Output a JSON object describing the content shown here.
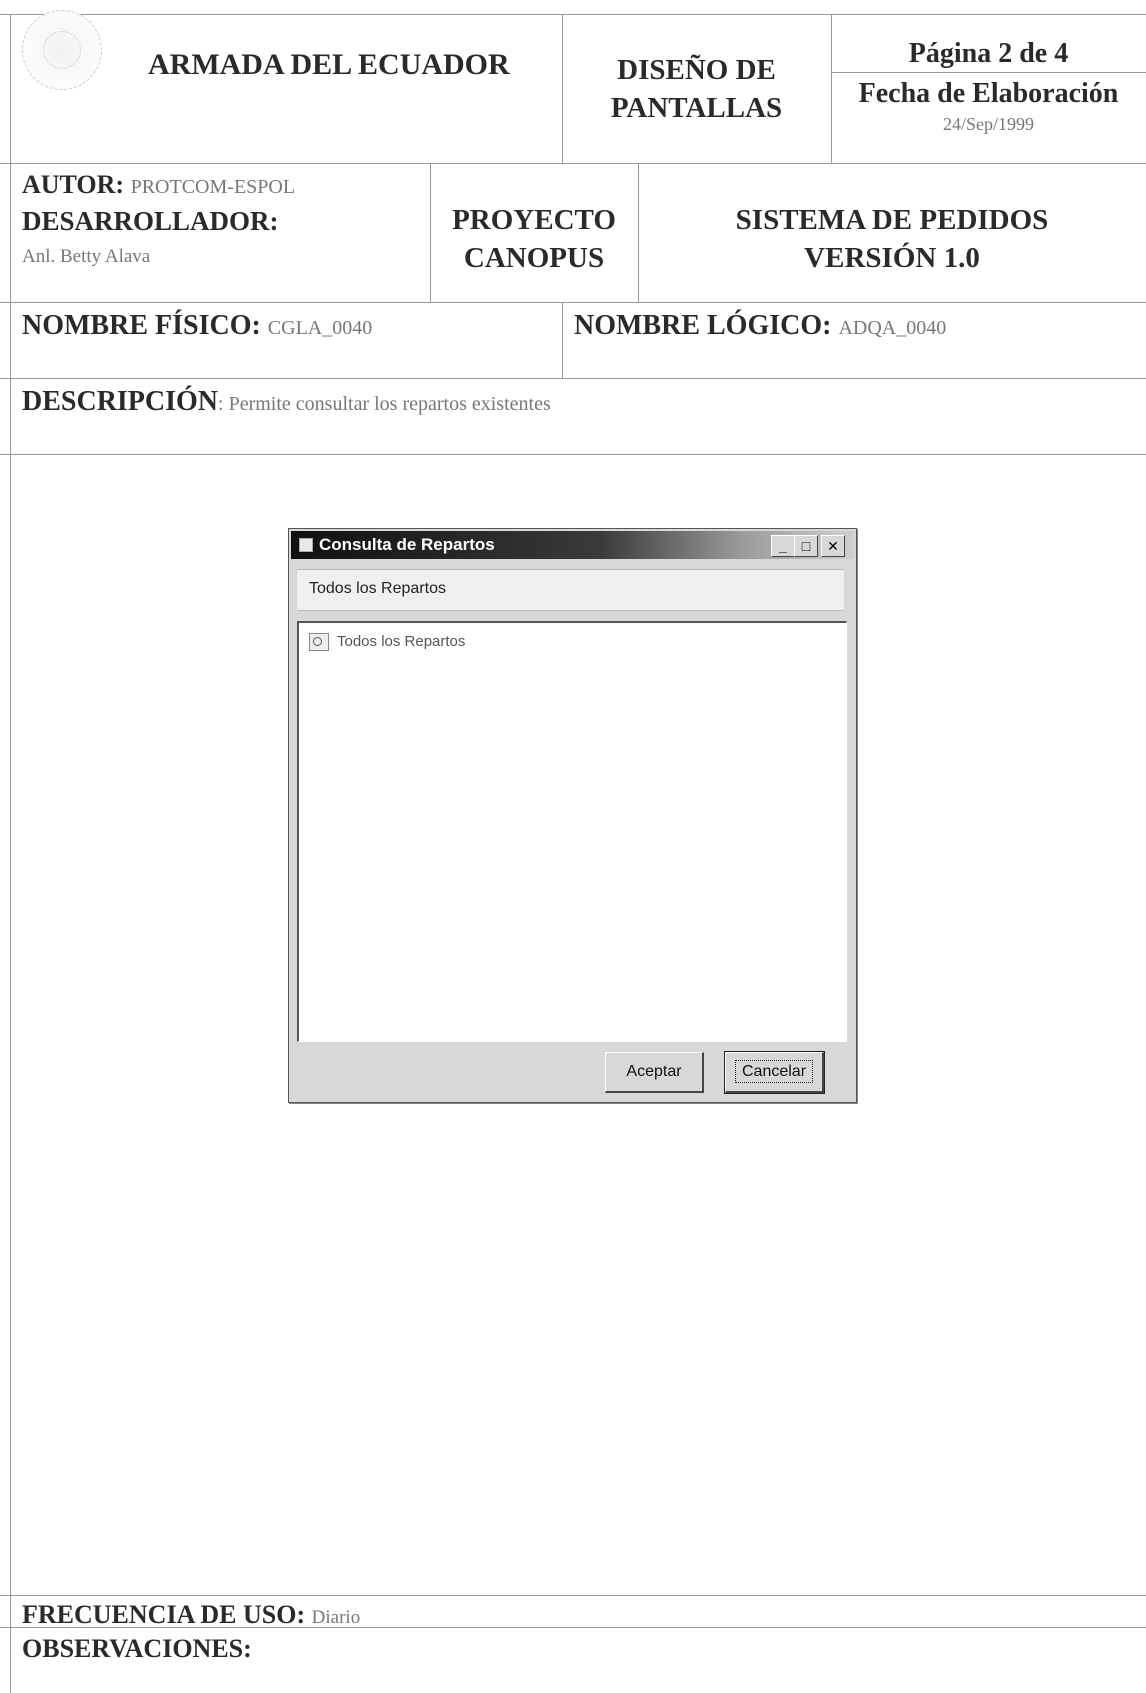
{
  "header": {
    "organization": "ARMADA DEL ECUADOR",
    "doc_type_line1": "DISEÑO DE",
    "doc_type_line2": "PANTALLAS",
    "page": "Página 2 de 4",
    "date_label": "Fecha de Elaboración",
    "date_value": "24/Sep/1999"
  },
  "author": {
    "label": "AUTOR:",
    "value": "PROTCOM-ESPOL",
    "developer_label": "DESARROLLADOR:",
    "developer_value": "Anl. Betty Alava"
  },
  "project": {
    "line1": "PROYECTO",
    "line2": "CANOPUS"
  },
  "system": {
    "line1": "SISTEMA DE PEDIDOS",
    "line2": "VERSIÓN 1.0"
  },
  "names": {
    "physical_label": "NOMBRE FÍSICO:",
    "physical_value": "CGLA_0040",
    "logical_label": "NOMBRE LÓGICO:",
    "logical_value": "ADQA_0040"
  },
  "description": {
    "label": "DESCRIPCIÓN",
    "value": ": Permite consultar los repartos existentes"
  },
  "dialog": {
    "title": "Consulta de Repartos",
    "tab_label": "Todos los Repartos",
    "tree_item": "Todos los Repartos",
    "accept_button": "Aceptar",
    "cancel_button": "Cancelar",
    "minimize": "_",
    "maximize": "□",
    "close": "✕"
  },
  "footer": {
    "frequency_label": "FRECUENCIA DE USO:",
    "frequency_value": "Diario",
    "observations_label": "OBSERVACIONES:"
  },
  "icons": [
    "seal-icon",
    "window-icon",
    "tree-item-icon"
  ]
}
